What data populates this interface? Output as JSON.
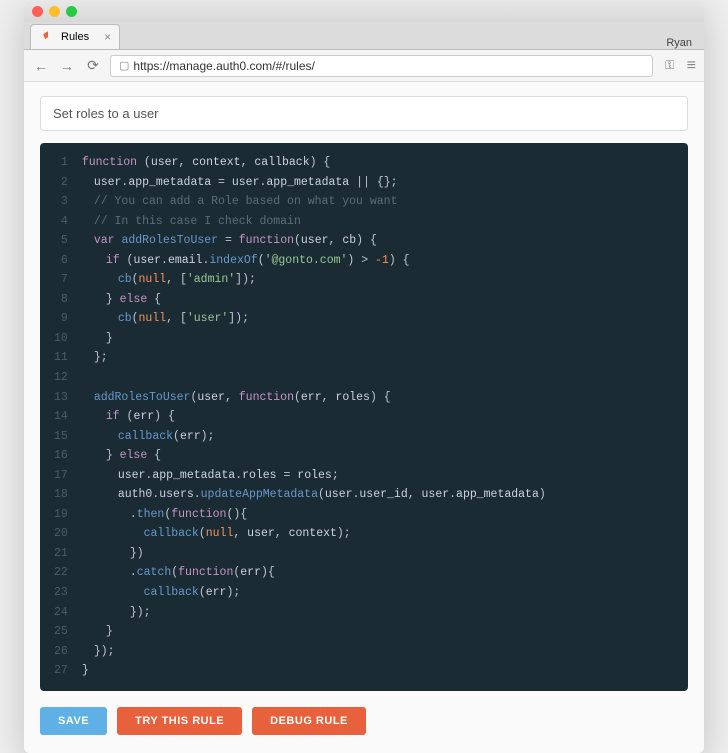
{
  "browser": {
    "tab_title": "Rules",
    "user": "Ryan",
    "url": "https://manage.auth0.com/#/rules/"
  },
  "rule_name": "Set roles to a user",
  "buttons": {
    "save": "SAVE",
    "try": "TRY THIS RULE",
    "debug": "DEBUG RULE"
  },
  "code_lines": 27
}
